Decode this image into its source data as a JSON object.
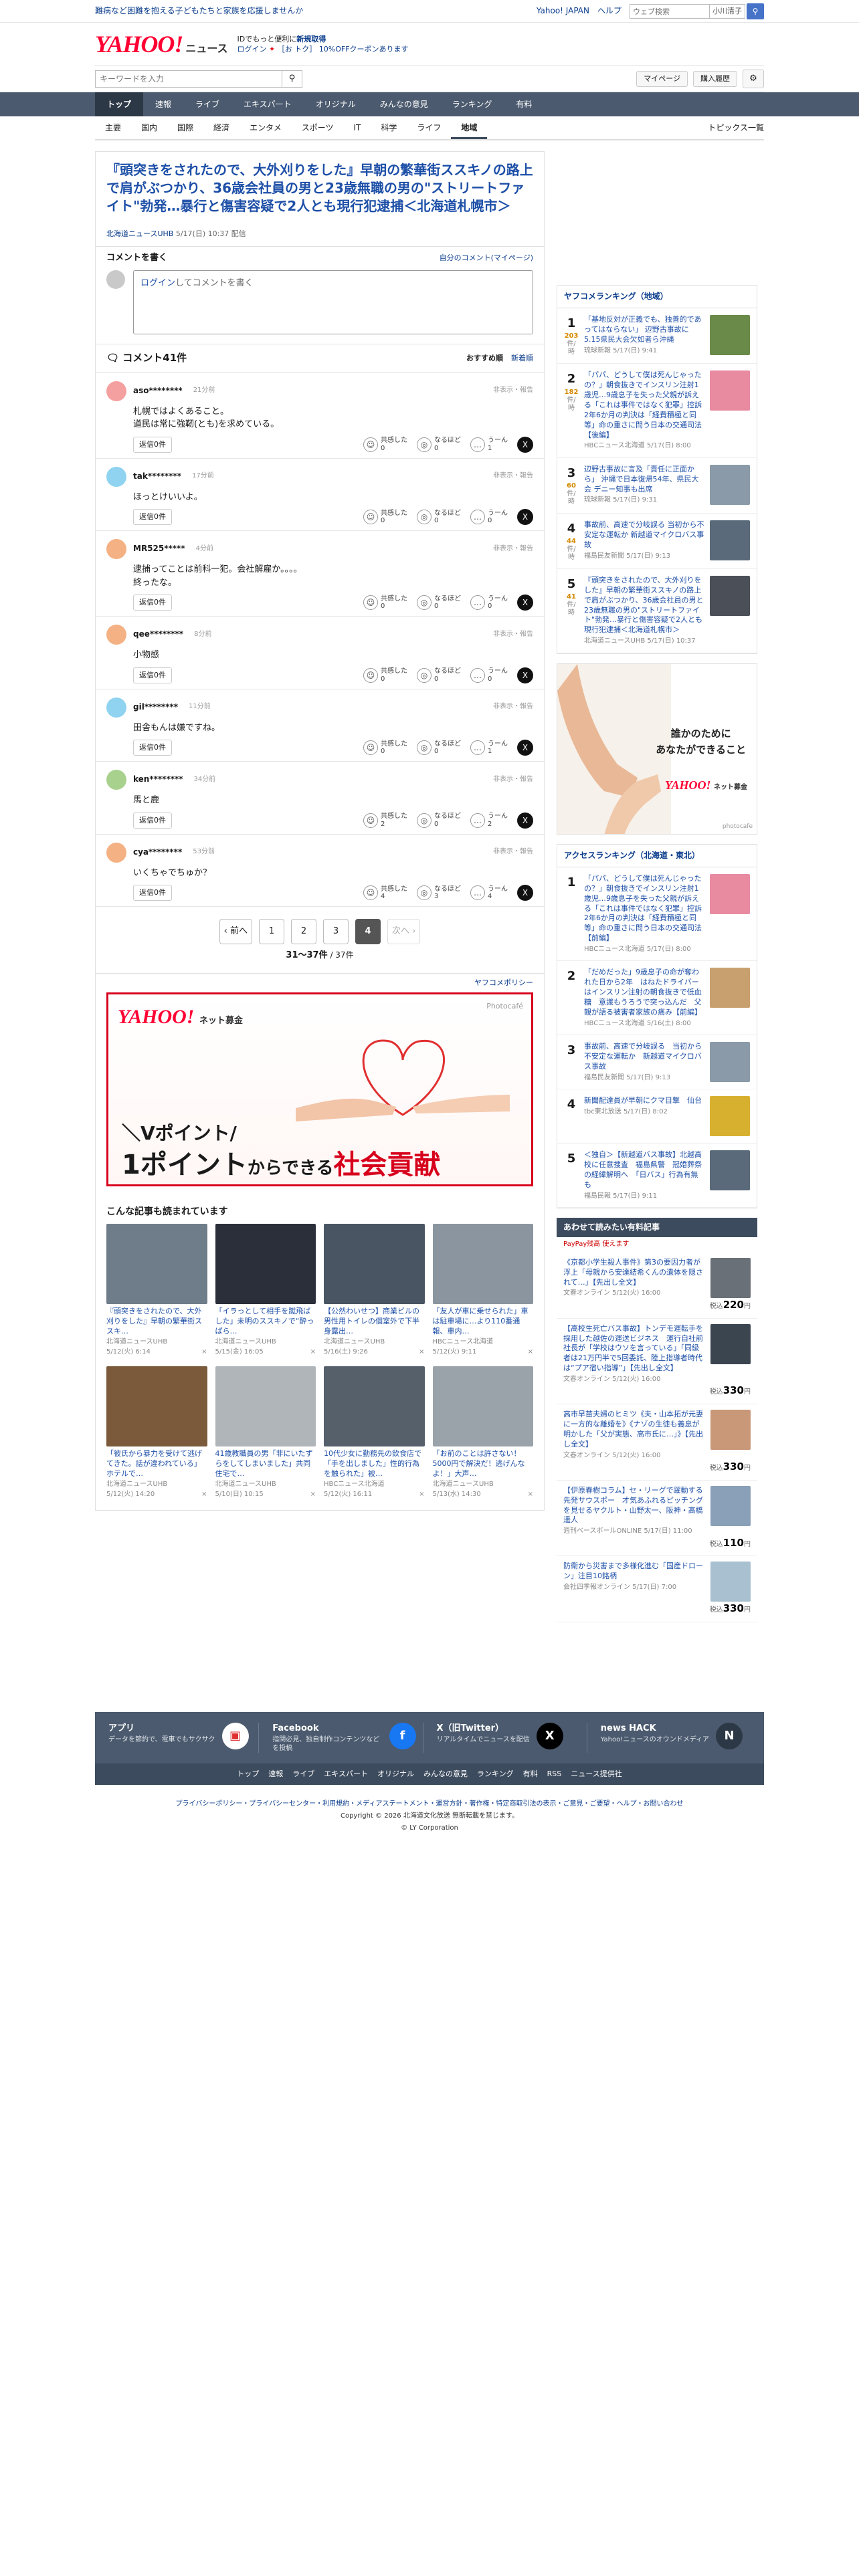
{
  "topbar": {
    "promo": "難病など困難を抱える子どもたちと家族を応援しませんか",
    "yahoo_japan": "Yahoo! JAPAN",
    "help": "ヘルプ",
    "search_placeholder": "ウェブ検索",
    "user": "小川清子"
  },
  "masthead": {
    "logo": "YAHOO!",
    "logo_sub": "ニュース",
    "line1": "IDでもっと便利に",
    "line1_link": "新規取得",
    "line2_login": "ログイン",
    "line2_coupon": "［お トク］ 10%OFFクーポンあります"
  },
  "subbar": {
    "keyword_placeholder": "キーワードを入力",
    "mypage": "マイページ",
    "history": "購入履歴"
  },
  "gnav": [
    "トップ",
    "速報",
    "ライブ",
    "エキスパート",
    "オリジナル",
    "みんなの意見",
    "ランキング",
    "有料"
  ],
  "cnav": [
    "主要",
    "国内",
    "国際",
    "経済",
    "エンタメ",
    "スポーツ",
    "IT",
    "科学",
    "ライフ",
    "地域"
  ],
  "cnav_right": "トピックス一覧",
  "article": {
    "headline": "『頭突きをされたので、大外刈りをした』早朝の繁華街ススキノの路上で肩がぶつかり、36歳会社員の男と23歳無職の男の\"ストリートファイト\"勃発…暴行と傷害容疑で2人とも現行犯逮捕＜北海道札幌市＞",
    "source": "北海道ニュースUHB",
    "date": "5/17(日) 10:37 配信"
  },
  "comment_write": {
    "title": "コメントを書く",
    "my_comments": "自分のコメント(マイページ)",
    "login": "ログイン",
    "prompt": "してコメントを書く"
  },
  "comments_head": {
    "count": "コメント41件",
    "sort_recommend": "おすすめ順",
    "sort_new": "新着順"
  },
  "comments": [
    {
      "user": "aso********",
      "time": "21分前",
      "body": "札幌ではよくあること。\n道民は常に強靭(とも)を求めている。",
      "reply": "返信0件",
      "r1": "共感した",
      "n1": "0",
      "r2": "なるほど",
      "n2": "0",
      "r3": "うーん",
      "n3": "1"
    },
    {
      "user": "tak********",
      "time": "17分前",
      "body": "ほっとけいいよ。",
      "reply": "返信0件",
      "r1": "共感した",
      "n1": "0",
      "r2": "なるほど",
      "n2": "0",
      "r3": "うーん",
      "n3": "0"
    },
    {
      "user": "MR525*****",
      "time": "4分前",
      "body": "逮捕ってことは前科一犯。会社解雇か。。。。\n終ったな。",
      "reply": "返信0件",
      "r1": "共感した",
      "n1": "0",
      "r2": "なるほど",
      "n2": "0",
      "r3": "うーん",
      "n3": "0"
    },
    {
      "user": "qee********",
      "time": "8分前",
      "body": "小物感",
      "reply": "返信0件",
      "r1": "共感した",
      "n1": "0",
      "r2": "なるほど",
      "n2": "0",
      "r3": "うーん",
      "n3": "0"
    },
    {
      "user": "gil********",
      "time": "11分前",
      "body": "田舎もんは嫌ですね。",
      "reply": "返信0件",
      "r1": "共感した",
      "n1": "0",
      "r2": "なるほど",
      "n2": "0",
      "r3": "うーん",
      "n3": "1"
    },
    {
      "user": "ken********",
      "time": "34分前",
      "body": "馬と鹿",
      "reply": "返信0件",
      "r1": "共感した",
      "n1": "2",
      "r2": "なるほど",
      "n2": "0",
      "r3": "うーん",
      "n3": "2"
    },
    {
      "user": "cya********",
      "time": "53分前",
      "body": "いくちゃでちゅか？",
      "reply": "返信0件",
      "r1": "共感した",
      "n1": "4",
      "r2": "なるほど",
      "n2": "3",
      "r3": "うーん",
      "n3": "4"
    }
  ],
  "report": "非表示・報告",
  "pager": {
    "prev": "前へ",
    "pages": [
      "1",
      "2",
      "3",
      "4"
    ],
    "current": "4",
    "next": "次へ",
    "count": "31〜37件",
    "total": "/ 37件"
  },
  "policy": "ヤフコメポリシー",
  "ad_main": {
    "brand": "YAHOO!",
    "brand_sub": "ネット募金",
    "photo": "Photocafé",
    "line1": "＼Vポイント/",
    "line2a": "1ポイント",
    "line2b": "からできる",
    "line2c": "社会貢献"
  },
  "related": {
    "title": "こんな記事も読まれています",
    "items": [
      {
        "title": "『頭突きをされたので、大外刈りをした』早朝の繁華街ススキ…",
        "src": "北海道ニュースUHB",
        "date": "5/12(火) 6:14"
      },
      {
        "title": "「イラっとして相手を蹴飛ばした」未明のススキノで“酔っぱら…",
        "src": "北海道ニュースUHB",
        "date": "5/15(金) 16:05"
      },
      {
        "title": "【公然わいせつ】商業ビルの男性用トイレの個室外で下半身露出…",
        "src": "北海道ニュースUHB",
        "date": "5/16(土) 9:26"
      },
      {
        "title": "「友人が車に乗せられた」車は駐車場に…より110番通報、車内…",
        "src": "HBCニュース北海道",
        "date": "5/12(火) 9:11"
      },
      {
        "title": "「彼氏から暴力を受けて逃げてきた。話が違われている」ホテルで…",
        "src": "北海道ニュースUHB",
        "date": "5/12(火) 14:20"
      },
      {
        "title": "41歳教職員の男「非にいたずらをしてしまいました」共同住宅で…",
        "src": "北海道ニュースUHB",
        "date": "5/10(日) 10:15"
      },
      {
        "title": "10代少女に勤務先の飲食店で「手を出しました」性的行為を触られた」被…",
        "src": "HBCニュース北海道",
        "date": "5/12(火) 16:11"
      },
      {
        "title": "「お前のことは許さない！ 5000円で解決だ！逃げんなよ！」大声…",
        "src": "北海道ニュースUHB",
        "date": "5/13(水) 14:30"
      }
    ]
  },
  "side_rank1": {
    "title": "ヤフコメランキング（地域）",
    "items": [
      {
        "n": "1",
        "c": "203",
        "u": "件/時",
        "title": "「基地反対が正義でも、独善的であってはならない」 辺野古事故に5.15県民大会欠如者ら沖縄",
        "src": "琉球新報 5/17(日) 9:41"
      },
      {
        "n": "2",
        "c": "182",
        "u": "件/時",
        "title": "「パパ、どうして僕は死んじゃったの？」朝食抜きでインスリン注射1歳児…9歳息子を失った父親が訴える「これは事件ではなく犯罪」控訴2年6か月の判決は「経費積極と同等」命の重さに問う日本の交通司法【後編】",
        "src": "HBCニュース北海道 5/17(日) 8:00"
      },
      {
        "n": "3",
        "c": "60",
        "u": "件/時",
        "title": "辺野古事故に言及「責任に正面から」 沖縄で日本復帰54年、県民大会 デニー知事も出席",
        "src": "琉球新報 5/17(日) 9:31"
      },
      {
        "n": "4",
        "c": "44",
        "u": "件/時",
        "title": "事故前、高速で分岐誤る 当初から不安定な運転か 新越道マイクロバス事故",
        "src": "福島民友新聞 5/17(日) 9:13"
      },
      {
        "n": "5",
        "c": "41",
        "u": "件/時",
        "title": "『頭突きをされたので、大外刈りをした』早朝の繁華街ススキノの路上で肩がぶつかり、36歳会社員の男と23歳無職の男の\"ストリートファイト\"勃発…暴行と傷害容疑で2人とも現行犯逮捕＜北海道札幌市＞",
        "src": "北海道ニュースUHB 5/17(日) 10:37"
      }
    ]
  },
  "side_ad": {
    "text1": "誰かのために",
    "text2": "あなたができること",
    "brand": "YAHOO!",
    "brand_sub": "ネット募金",
    "photo": "photocafe"
  },
  "side_rank2": {
    "title": "アクセスランキング（北海道・東北）",
    "items": [
      {
        "n": "1",
        "title": "「パパ、どうして僕は死んじゃったの？」朝食抜きでインスリン注射1歳児…9歳息子を失った父親が訴える「これは事件ではなく犯罪」控訴2年6か月の判決は「経費積極と同等」命の重さに問う日本の交通司法【前編】",
        "src": "HBCニュース北海道 5/17(日) 8:00"
      },
      {
        "n": "2",
        "title": "「だめだった」9歳息子の命が奪われた日から2年　はねたドライバーはインスリン注射の朝食抜きで低血糖　意識もうろうで突っ込んだ　父親が語る被害者家族の痛み【前編】",
        "src": "HBCニュース北海道 5/16(土) 8:00"
      },
      {
        "n": "3",
        "title": "事故前、高速で分岐誤る　当初から不安定な運転か　新越道マイクロバス事故",
        "src": "福島民友新聞 5/17(日) 9:13"
      },
      {
        "n": "4",
        "title": "新聞配達員が早朝にクマ目撃　仙台",
        "src": "tbc東北放送 5/17(日) 8:02"
      },
      {
        "n": "5",
        "title": "＜独自＞【新越道バス事故】北越高校に任意捜査　福島県警　冠婚葬祭の経緯解明へ　「日バス」行為有無も",
        "src": "福島民報 5/17(日) 9:11"
      }
    ]
  },
  "paid": {
    "title": "あわせて読みたい有料記事",
    "paypay": "PayPay残高 使えます",
    "items": [
      {
        "title": "《京都小学生殺人事件》第3の要因力者が浮上「母親から安達結希くんの遺体を隠されて…」【先出し全文】",
        "src": "文春オンライン 5/12(火) 16:00",
        "price": "220",
        "unit": "税込",
        "yen": "円"
      },
      {
        "title": "【高校生死亡バス事故】トンデモ運転手を採用した越佐の運送ビジネス　運行自社前社長が「学校はウソを言っている」「同級者は21万円半で5回委託、陸上指導者時代は“プア宿い指導”」【先出し全文】",
        "src": "文春オンライン 5/12(火) 16:00",
        "price": "330",
        "unit": "税込",
        "yen": "円"
      },
      {
        "title": "高市早苗夫婦のヒミツ《夫・山本拓が元妻に一方的な離婚を》《ナゾの生徒も義息が明かした「父が実態、高市氏に…」》【先出し全文】",
        "src": "文春オンライン 5/12(火) 16:00",
        "price": "330",
        "unit": "税込",
        "yen": "円"
      },
      {
        "title": "【伊原春樹コラム】セ・リーグで躍動する先発サウスポー　才気あふれるピッチングを見せるヤクルト・山野太一、阪神・高橋遥人",
        "src": "週刊ベースボールONLINE 5/17(日) 11:00",
        "price": "110",
        "unit": "税込",
        "yen": "円"
      },
      {
        "title": "防衛から災害まで多様化進む「国産ドローン」注目10銘柄",
        "src": "会社四季報オンライン 5/17(日) 7:00",
        "price": "330",
        "unit": "税込",
        "yen": "円"
      }
    ]
  },
  "footer": {
    "apps": [
      {
        "t": "アプリ",
        "d": "データを節約で、電車でもサクサク"
      },
      {
        "t": "Facebook",
        "d": "指関必見、独自制作コンテンツなどを投稿"
      },
      {
        "t": "X（旧Twitter）",
        "d": "リアルタイムでニュースを配信"
      },
      {
        "t": "news HACK",
        "d": "Yahoo!ニュースのオウンドメディア"
      }
    ],
    "links": [
      "トップ",
      "速報",
      "ライブ",
      "エキスパート",
      "オリジナル",
      "みんなの意見",
      "ランキング",
      "有料",
      "RSS",
      "ニュース提供社"
    ],
    "legal": "プライバシーポリシー・プライバシーセンター・利用規約・メディアステートメント・運営方針・著作権・特定商取引法の表示・ご意見・ご要望・ヘルプ・お問い合わせ",
    "copy": "Copyright © 2026 北海道文化放送 無断転載を禁じます。",
    "corp": "© LY Corporation"
  }
}
